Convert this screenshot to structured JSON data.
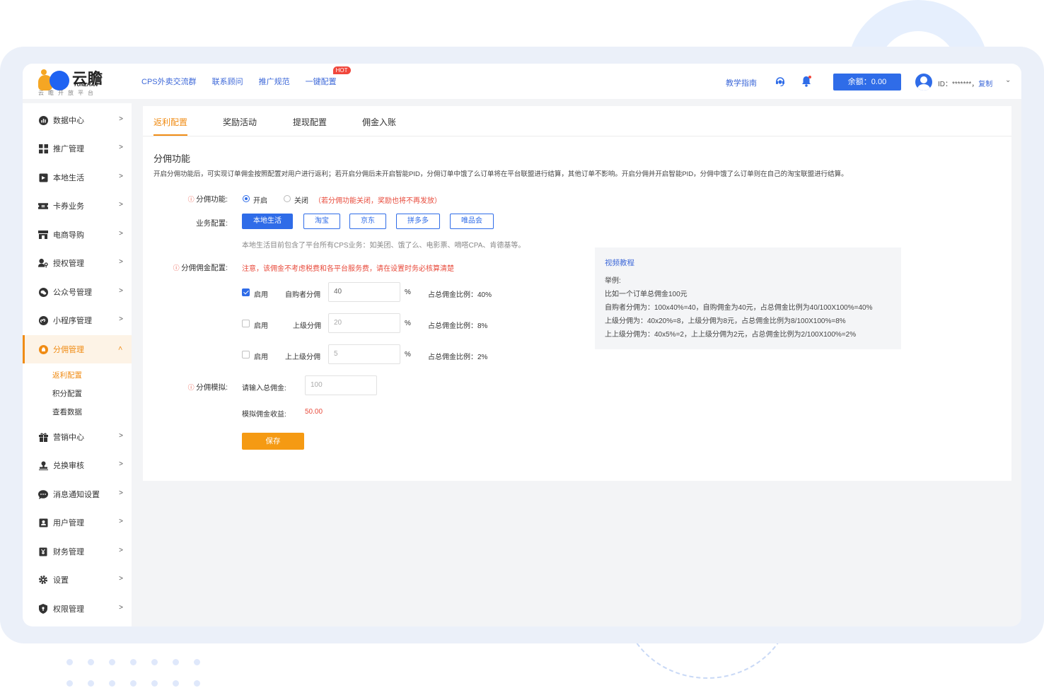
{
  "app": {
    "logo_text": "云瞻",
    "logo_en": "YUNZHAN",
    "logo_sub": "云瞻开放平台"
  },
  "topnav": [
    {
      "label": "CPS外卖交流群"
    },
    {
      "label": "联系顾问"
    },
    {
      "label": "推广规范"
    },
    {
      "label": "一键配置",
      "badge": "HOT"
    }
  ],
  "header": {
    "guide": "教学指南",
    "balance": "余额：0.00",
    "user_id": "ID：*******，",
    "copy": "复制"
  },
  "sidebar": {
    "items": [
      {
        "label": "数据中心",
        "icon": "chart-icon"
      },
      {
        "label": "推广管理",
        "icon": "grid-icon"
      },
      {
        "label": "本地生活",
        "icon": "shop-icon"
      },
      {
        "label": "卡券业务",
        "icon": "ticket-icon"
      },
      {
        "label": "电商导购",
        "icon": "store-icon"
      },
      {
        "label": "授权管理",
        "icon": "user-key-icon"
      },
      {
        "label": "公众号管理",
        "icon": "wechat-icon"
      },
      {
        "label": "小程序管理",
        "icon": "mini-program-icon"
      },
      {
        "label": "分佣管理",
        "icon": "coin-icon",
        "active": true
      },
      {
        "label": "营销中心",
        "icon": "gift-icon"
      },
      {
        "label": "兑换审核",
        "icon": "stamp-icon"
      },
      {
        "label": "消息通知设置",
        "icon": "message-icon"
      },
      {
        "label": "用户管理",
        "icon": "contacts-icon"
      },
      {
        "label": "财务管理",
        "icon": "finance-icon"
      },
      {
        "label": "设置",
        "icon": "gear-icon"
      },
      {
        "label": "权限管理",
        "icon": "shield-icon"
      }
    ],
    "sub_items": [
      {
        "label": "返利配置",
        "active": true
      },
      {
        "label": "积分配置"
      },
      {
        "label": "查看数据"
      }
    ]
  },
  "tabs": [
    {
      "label": "返利配置",
      "active": true
    },
    {
      "label": "奖励活动"
    },
    {
      "label": "提现配置"
    },
    {
      "label": "佣金入账"
    }
  ],
  "section": {
    "title": "分佣功能",
    "desc": "开启分佣功能后，可实现订单佣金按照配置对用户进行返利；若开启分佣后未开启智能PID，分佣订单中饿了么订单将在平台联盟进行结算，其他订单不影响。开启分佣并开启智能PID，分佣中饿了么订单则在自己的淘宝联盟进行结算。"
  },
  "form": {
    "func_label": "分佣功能:",
    "radio_on": "开启",
    "radio_off": "关闭",
    "func_note": "（若分佣功能关闭，奖励也将不再发放）",
    "biz_label": "业务配置:",
    "biz_buttons": [
      {
        "label": "本地生活",
        "active": true
      },
      {
        "label": "淘宝"
      },
      {
        "label": "京东"
      },
      {
        "label": "拼多多"
      },
      {
        "label": "唯品会"
      }
    ],
    "biz_note": "本地生活目前包含了平台所有CPS业务：如美团、饿了么、电影票、嘀嗒CPA、肯德基等。",
    "commission_label": "分佣佣金配置:",
    "commission_warning": "注意，该佣金不考虑税费和各平台服务费，请在设置时务必核算清楚",
    "rows": [
      {
        "enabled": true,
        "enable_label": "启用",
        "name": "自购者分佣",
        "value": "40",
        "unit": "%",
        "ratio": "占总佣金比例：40%"
      },
      {
        "enabled": false,
        "enable_label": "启用",
        "name": "上级分佣",
        "value": "20",
        "unit": "%",
        "ratio": "占总佣金比例：8%"
      },
      {
        "enabled": false,
        "enable_label": "启用",
        "name": "上上级分佣",
        "value": "5",
        "unit": "%",
        "ratio": "占总佣金比例：2%"
      }
    ],
    "sim_label": "分佣模拟:",
    "sim_input_label": "请输入总佣金:",
    "sim_input_value": "100",
    "sim_result_label": "模拟佣金收益:",
    "sim_result_value": "50.00",
    "save": "保存"
  },
  "tutorial": {
    "title": "视频教程",
    "lines": [
      "举例:",
      "比如一个订单总佣金100元",
      "自购者分佣为：100x40%=40，自购佣金为40元，占总佣金比例为40/100X100%=40%",
      "上级分佣为：40x20%=8，上级分佣为8元，占总佣金比例为8/100X100%=8%",
      "上上级分佣为：40x5%=2，上上级分佣为2元，占总佣金比例为2/100X100%=2%"
    ]
  },
  "colors": {
    "primary": "#2f6ce8",
    "accent": "#f08c15",
    "warning": "#e84b3c"
  }
}
